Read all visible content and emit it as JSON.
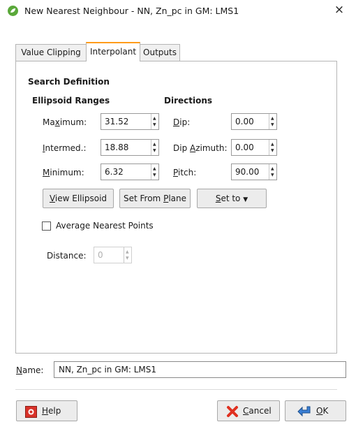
{
  "window": {
    "title": "New Nearest Neighbour - NN, Zn_pc in GM: LMS1",
    "close_glyph": "×"
  },
  "tabs": [
    {
      "label": "Value Clipping",
      "active": false
    },
    {
      "label": "Interpolant",
      "active": true
    },
    {
      "label": "Outputs",
      "active": false
    }
  ],
  "search": {
    "section_title": "Search Definition",
    "ellipsoid_title": "Ellipsoid Ranges",
    "directions_title": "Directions",
    "maximum": {
      "pre": "Ma",
      "key": "x",
      "post": "imum:",
      "value": "31.52"
    },
    "intermed": {
      "pre": "",
      "key": "I",
      "post": "ntermed.:",
      "value": "18.88"
    },
    "minimum": {
      "pre": "",
      "key": "M",
      "post": "inimum:",
      "value": "6.32"
    },
    "dip": {
      "pre": "",
      "key": "D",
      "post": "ip:",
      "value": "0.00"
    },
    "dip_azimuth": {
      "pre": "Dip ",
      "key": "A",
      "post": "zimuth:",
      "value": "0.00"
    },
    "pitch": {
      "pre": "",
      "key": "P",
      "post": "itch:",
      "value": "90.00"
    }
  },
  "buttons": {
    "view_ellipsoid": {
      "pre": "",
      "key": "V",
      "post": "iew Ellipsoid"
    },
    "set_from_plane": {
      "pre": "Set From ",
      "key": "P",
      "post": "lane"
    },
    "set_to": {
      "pre": "",
      "key": "S",
      "post": "et to",
      "arrow": "▼"
    }
  },
  "average": {
    "label": "Average Nearest Points",
    "checked": false,
    "distance_label": "Distance:",
    "distance_value": "0"
  },
  "name": {
    "label_key": "N",
    "label_post": "ame:",
    "value": "NN, Zn_pc in GM: LMS1"
  },
  "footer": {
    "help": {
      "key": "H",
      "post": "elp"
    },
    "cancel": {
      "key": "C",
      "post": "ancel"
    },
    "ok": {
      "key": "O",
      "post": "K"
    }
  },
  "colors": {
    "active_tab_accent": "#ff9c1a",
    "app_icon": "#5aa83a",
    "help_icon": "#d8322a",
    "cancel_icon": "#e03020",
    "ok_icon": "#3a7fd5"
  },
  "icons": {
    "app": "app-leaf-icon",
    "help": "help-lifebuoy-icon",
    "cancel": "cancel-x-icon",
    "ok": "ok-arrow-icon",
    "close": "close-icon"
  }
}
